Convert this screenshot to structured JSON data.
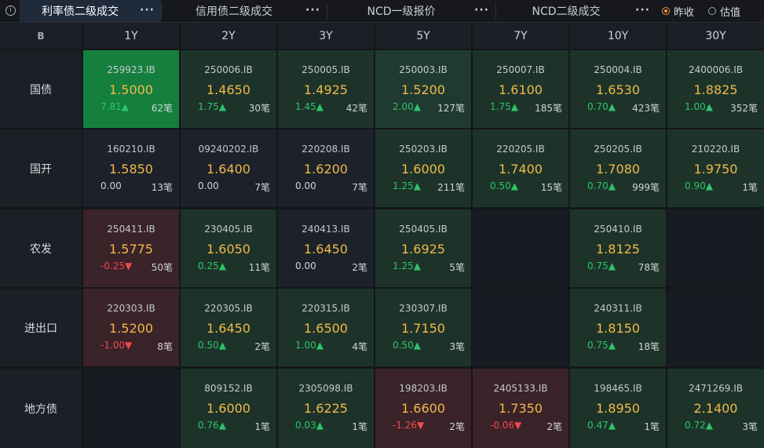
{
  "tabs": [
    {
      "label": "利率债二级成交",
      "active": true
    },
    {
      "label": "信用债二级成交",
      "active": false
    },
    {
      "label": "NCD一级报价",
      "active": false
    },
    {
      "label": "NCD二级成交",
      "active": false
    }
  ],
  "tab_more": "···",
  "info_icon": "i",
  "corner_icon": "B",
  "radios": [
    {
      "label": "昨收",
      "checked": true
    },
    {
      "label": "估值",
      "checked": false
    }
  ],
  "columns": [
    "1Y",
    "2Y",
    "3Y",
    "5Y",
    "7Y",
    "10Y",
    "30Y"
  ],
  "rows": [
    {
      "label": "国债",
      "cells": [
        {
          "code": "259923.IB",
          "price": "1.5000",
          "change": "7.81▲",
          "count": "62笔",
          "dir": "up",
          "bg": "gs"
        },
        {
          "code": "250006.IB",
          "price": "1.4650",
          "change": "1.75▲",
          "count": "30笔",
          "dir": "up",
          "bg": "g2"
        },
        {
          "code": "250005.IB",
          "price": "1.4925",
          "change": "1.45▲",
          "count": "42笔",
          "dir": "up",
          "bg": "g2"
        },
        {
          "code": "250003.IB",
          "price": "1.5200",
          "change": "2.00▲",
          "count": "127笔",
          "dir": "up",
          "bg": "g1"
        },
        {
          "code": "250007.IB",
          "price": "1.6100",
          "change": "1.75▲",
          "count": "185笔",
          "dir": "up",
          "bg": "g2"
        },
        {
          "code": "250004.IB",
          "price": "1.6530",
          "change": "0.70▲",
          "count": "423笔",
          "dir": "up",
          "bg": "g2"
        },
        {
          "code": "2400006.IB",
          "price": "1.8825",
          "change": "1.00▲",
          "count": "352笔",
          "dir": "up",
          "bg": "g2"
        }
      ]
    },
    {
      "label": "国开",
      "cells": [
        {
          "code": "160210.IB",
          "price": "1.5850",
          "change": "0.00",
          "count": "13笔",
          "dir": "flat",
          "bg": "n"
        },
        {
          "code": "09240202.IB",
          "price": "1.6400",
          "change": "0.00",
          "count": "7笔",
          "dir": "flat",
          "bg": "n"
        },
        {
          "code": "220208.IB",
          "price": "1.6200",
          "change": "0.00",
          "count": "7笔",
          "dir": "flat",
          "bg": "n"
        },
        {
          "code": "250203.IB",
          "price": "1.6000",
          "change": "1.25▲",
          "count": "211笔",
          "dir": "up",
          "bg": "g2"
        },
        {
          "code": "220205.IB",
          "price": "1.7400",
          "change": "0.50▲",
          "count": "15笔",
          "dir": "up",
          "bg": "g2"
        },
        {
          "code": "250205.IB",
          "price": "1.7080",
          "change": "0.70▲",
          "count": "999笔",
          "dir": "up",
          "bg": "g2"
        },
        {
          "code": "210220.IB",
          "price": "1.9750",
          "change": "0.90▲",
          "count": "1笔",
          "dir": "up",
          "bg": "g2"
        }
      ]
    },
    {
      "label": "农发",
      "cells": [
        {
          "code": "250411.IB",
          "price": "1.5775",
          "change": "-0.25▼",
          "count": "50笔",
          "dir": "down",
          "bg": "r"
        },
        {
          "code": "230405.IB",
          "price": "1.6050",
          "change": "0.25▲",
          "count": "11笔",
          "dir": "up",
          "bg": "g2"
        },
        {
          "code": "240413.IB",
          "price": "1.6450",
          "change": "0.00",
          "count": "2笔",
          "dir": "flat",
          "bg": "n"
        },
        {
          "code": "250405.IB",
          "price": "1.6925",
          "change": "1.25▲",
          "count": "5笔",
          "dir": "up",
          "bg": "g2"
        },
        null,
        {
          "code": "250410.IB",
          "price": "1.8125",
          "change": "0.75▲",
          "count": "78笔",
          "dir": "up",
          "bg": "g2"
        },
        null
      ]
    },
    {
      "label": "进出口",
      "cells": [
        {
          "code": "220303.IB",
          "price": "1.5200",
          "change": "-1.00▼",
          "count": "8笔",
          "dir": "down",
          "bg": "r"
        },
        {
          "code": "220305.IB",
          "price": "1.6450",
          "change": "0.50▲",
          "count": "2笔",
          "dir": "up",
          "bg": "g2"
        },
        {
          "code": "220315.IB",
          "price": "1.6500",
          "change": "1.00▲",
          "count": "4笔",
          "dir": "up",
          "bg": "g2"
        },
        {
          "code": "230307.IB",
          "price": "1.7150",
          "change": "0.50▲",
          "count": "3笔",
          "dir": "up",
          "bg": "g2"
        },
        null,
        {
          "code": "240311.IB",
          "price": "1.8150",
          "change": "0.75▲",
          "count": "18笔",
          "dir": "up",
          "bg": "g2"
        },
        null
      ]
    },
    {
      "label": "地方债",
      "cells": [
        null,
        {
          "code": "809152.IB",
          "price": "1.6000",
          "change": "0.76▲",
          "count": "1笔",
          "dir": "up",
          "bg": "g2"
        },
        {
          "code": "2305098.IB",
          "price": "1.6225",
          "change": "0.03▲",
          "count": "1笔",
          "dir": "up",
          "bg": "g2"
        },
        {
          "code": "198203.IB",
          "price": "1.6600",
          "change": "-1.26▼",
          "count": "2笔",
          "dir": "down",
          "bg": "r"
        },
        {
          "code": "2405133.IB",
          "price": "1.7350",
          "change": "-0.06▼",
          "count": "2笔",
          "dir": "down",
          "bg": "r"
        },
        {
          "code": "198465.IB",
          "price": "1.8950",
          "change": "0.47▲",
          "count": "1笔",
          "dir": "up",
          "bg": "g2"
        },
        {
          "code": "2471269.IB",
          "price": "2.1400",
          "change": "0.72▲",
          "count": "3笔",
          "dir": "up",
          "bg": "g2"
        }
      ]
    }
  ]
}
